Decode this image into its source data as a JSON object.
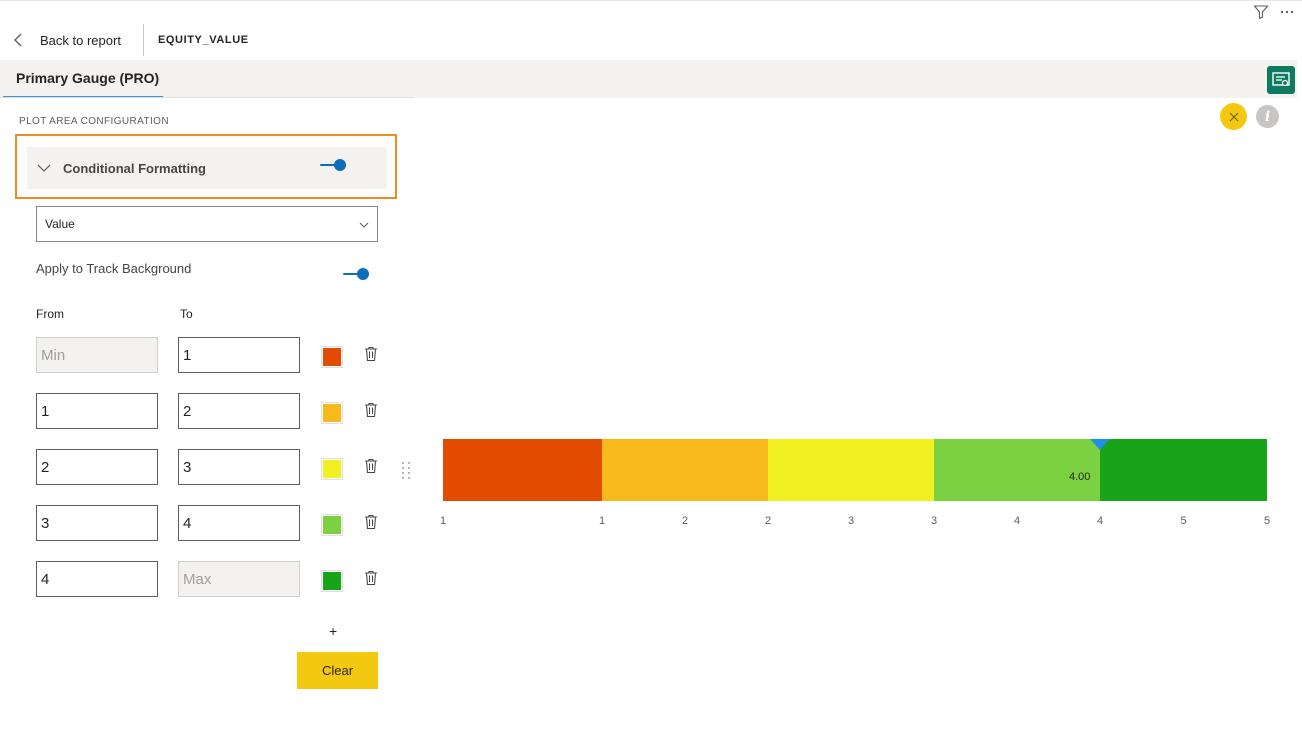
{
  "header": {
    "back_label": "Back to report",
    "measure_name": "EQUITY_VALUE"
  },
  "tab": {
    "label": "Primary Gauge (PRO)"
  },
  "panel": {
    "section_label": "PLOT AREA CONFIGURATION",
    "conditional_formatting_label": "Conditional Formatting",
    "conditional_formatting_on": true,
    "mode_select_value": "Value",
    "apply_track_label": "Apply to Track Background",
    "apply_track_on": true,
    "from_header": "From",
    "to_header": "To",
    "rules": [
      {
        "from": "",
        "from_placeholder": "Min",
        "to": "1",
        "to_placeholder": "",
        "color": "#e34b00"
      },
      {
        "from": "1",
        "from_placeholder": "",
        "to": "2",
        "to_placeholder": "",
        "color": "#f7b91b"
      },
      {
        "from": "2",
        "from_placeholder": "",
        "to": "3",
        "to_placeholder": "",
        "color": "#f0f022"
      },
      {
        "from": "3",
        "from_placeholder": "",
        "to": "4",
        "to_placeholder": "",
        "color": "#7cd143"
      },
      {
        "from": "4",
        "from_placeholder": "",
        "to": "",
        "to_placeholder": "Max",
        "color": "#18a418"
      }
    ],
    "add_label": "+",
    "clear_label": "Clear"
  },
  "chart_data": {
    "type": "bar",
    "orientation": "horizontal linear gauge",
    "bands": [
      {
        "from": 0.5,
        "to": 1,
        "color": "#e34b00"
      },
      {
        "from": 1,
        "to": 2,
        "color": "#f7b91b"
      },
      {
        "from": 2,
        "to": 3,
        "color": "#f0f022"
      },
      {
        "from": 3,
        "to": 4,
        "color": "#7cd143"
      },
      {
        "from": 4,
        "to": 5,
        "color": "#18a418"
      }
    ],
    "value": 4,
    "value_label": "4.00",
    "tick_labels": [
      "1",
      "1",
      "2",
      "2",
      "3",
      "3",
      "4",
      "4",
      "5",
      "5"
    ],
    "tick_values": [
      0.5,
      1,
      1.5,
      2,
      2.5,
      3,
      3.5,
      4,
      4.5,
      5
    ],
    "xlim": [
      0.5,
      5
    ],
    "marker_color": "#1e90e8"
  }
}
